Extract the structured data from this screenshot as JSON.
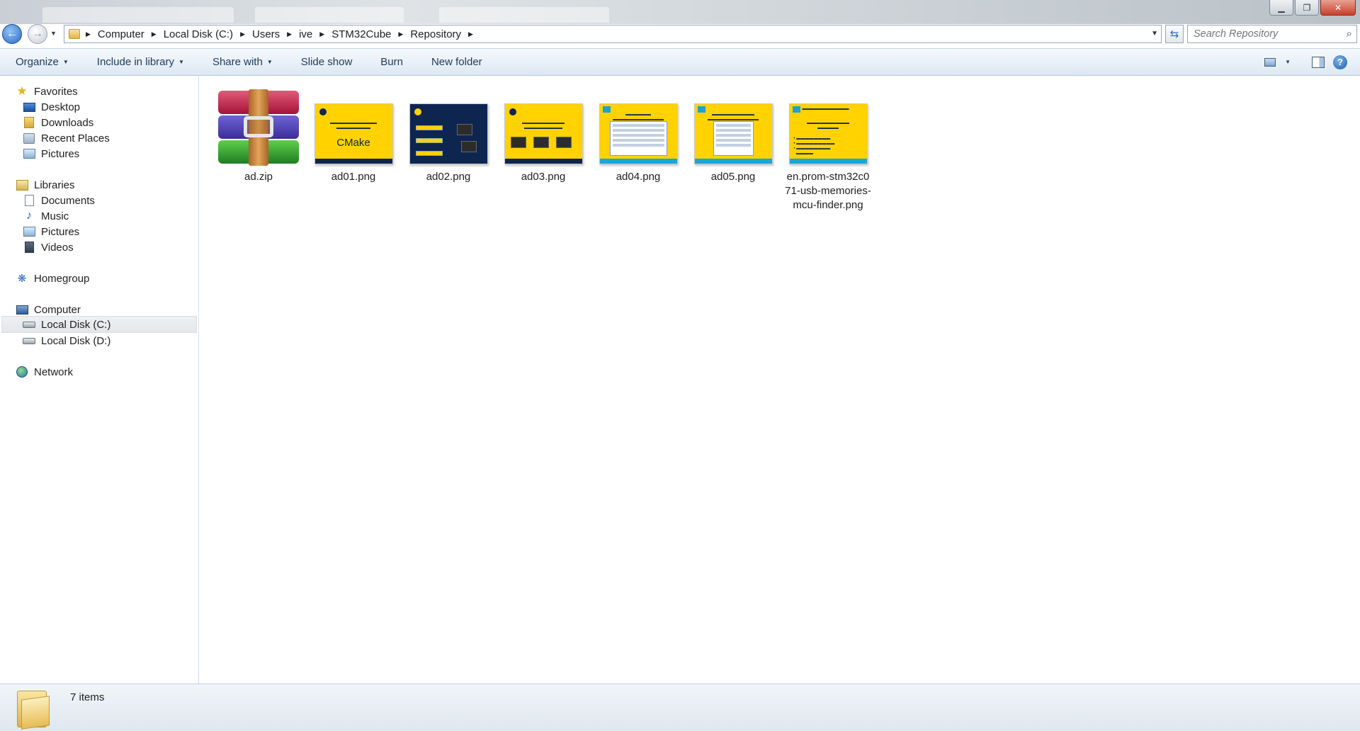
{
  "window": {
    "buttons": {
      "minimize": "▁",
      "maximize": "❐",
      "close": "✕"
    }
  },
  "address": {
    "breadcrumbs": [
      "Computer",
      "Local Disk (C:)",
      "Users",
      "ive",
      "STM32Cube",
      "Repository"
    ],
    "search_placeholder": "Search Repository"
  },
  "toolbar": {
    "organize": "Organize",
    "include_in_library": "Include in library",
    "share_with": "Share with",
    "slide_show": "Slide show",
    "burn": "Burn",
    "new_folder": "New folder"
  },
  "navigation": {
    "favorites": {
      "label": "Favorites",
      "items": [
        "Desktop",
        "Downloads",
        "Recent Places",
        "Pictures"
      ]
    },
    "libraries": {
      "label": "Libraries",
      "items": [
        "Documents",
        "Music",
        "Pictures",
        "Videos"
      ]
    },
    "homegroup": "Homegroup",
    "computer": {
      "label": "Computer",
      "items": [
        "Local Disk (C:)",
        "Local Disk (D:)"
      ]
    },
    "network": "Network",
    "selected": "Local Disk (C:)"
  },
  "files": [
    {
      "name": "ad.zip",
      "icon": "winrar-archive-icon"
    },
    {
      "name": "ad01.png",
      "icon": "image-thumbnail"
    },
    {
      "name": "ad02.png",
      "icon": "image-thumbnail"
    },
    {
      "name": "ad03.png",
      "icon": "image-thumbnail"
    },
    {
      "name": "ad04.png",
      "icon": "image-thumbnail"
    },
    {
      "name": "ad05.png",
      "icon": "image-thumbnail"
    },
    {
      "name": "en.prom-stm32c071-usb-memories-mcu-finder.png",
      "icon": "image-thumbnail"
    }
  ],
  "thumbnails": {
    "ad01_big": "CMake"
  },
  "status": {
    "item_count": "7 items"
  },
  "colors": {
    "accent_yellow": "#ffd200",
    "st_navy": "#0e2550",
    "commandbar": "#dde8f3",
    "selection": "#e4e7ea"
  }
}
